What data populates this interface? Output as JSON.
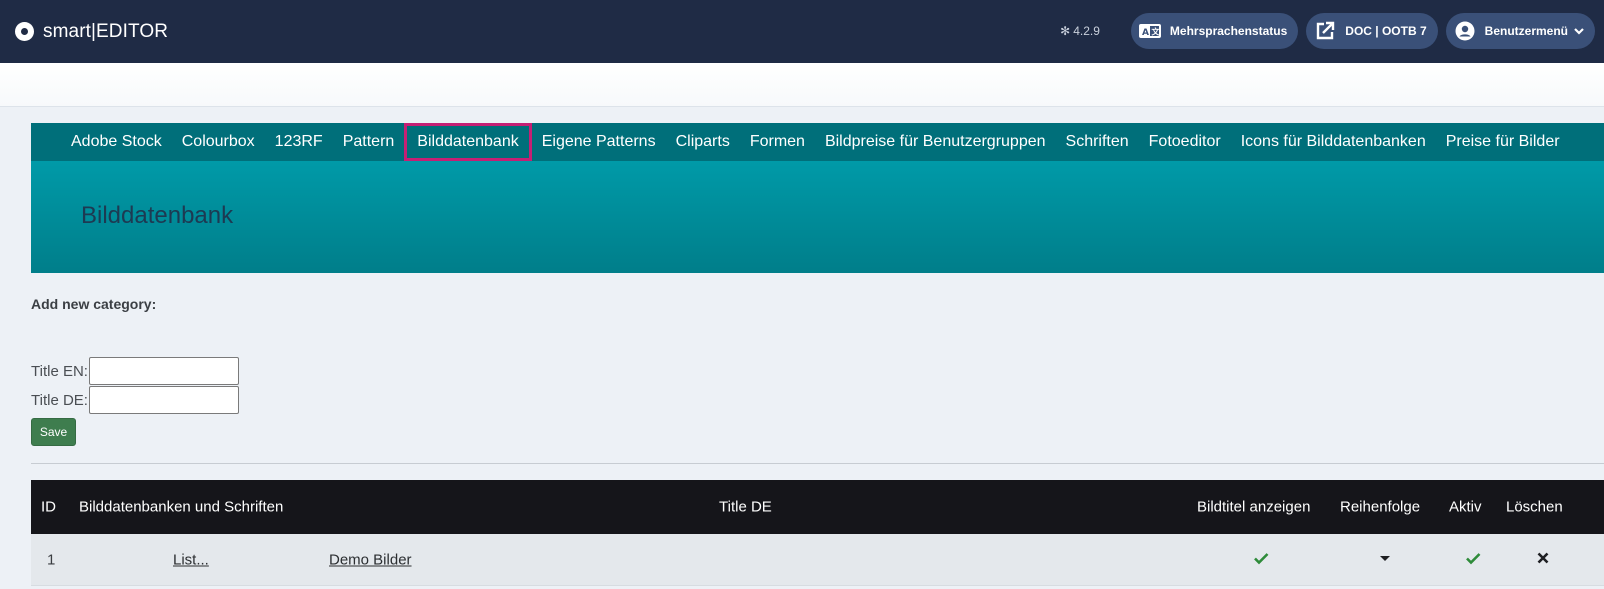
{
  "header": {
    "brand": "smart|EDITOR",
    "version": "4.2.9",
    "buttons": [
      {
        "label": "Mehrsprachenstatus",
        "icon": "language-icon"
      },
      {
        "label": "DOC | OOTB 7",
        "icon": "external-link-icon"
      },
      {
        "label": "Benutzermenü",
        "icon": "user-circle-icon"
      }
    ]
  },
  "nav": {
    "items": [
      "Adobe Stock",
      "Colourbox",
      "123RF",
      "Pattern",
      "Bilddatenbank",
      "Eigene Patterns",
      "Cliparts",
      "Formen",
      "Bildpreise für Benutzergruppen",
      "Schriften",
      "Fotoeditor",
      "Icons für Bilddatenbanken",
      "Preise für Bilder"
    ],
    "active": "Bilddatenbank"
  },
  "page": {
    "title": "Bilddatenbank"
  },
  "form": {
    "heading": "Add new category:",
    "title_en_label": "Title EN:",
    "title_en_value": "",
    "title_de_label": "Title DE:",
    "title_de_value": "",
    "save_label": "Save"
  },
  "table": {
    "columns": [
      "ID",
      "Bilddatenbanken und Schriften",
      "Title DE",
      "Bildtitel anzeigen",
      "Reihenfolge",
      "Aktiv",
      "Löschen"
    ],
    "rows": [
      {
        "id": "1",
        "list": "List...",
        "title": "Demo Bilder",
        "show_title": "check-icon",
        "order": "caret-down-icon",
        "active": "check-icon",
        "delete": "close-icon"
      }
    ]
  },
  "colors": {
    "header": "#1f2b45",
    "nav": "#006f7a",
    "active_border": "#c51f74",
    "save": "#3e7d4e",
    "check": "#2e8b3a"
  }
}
